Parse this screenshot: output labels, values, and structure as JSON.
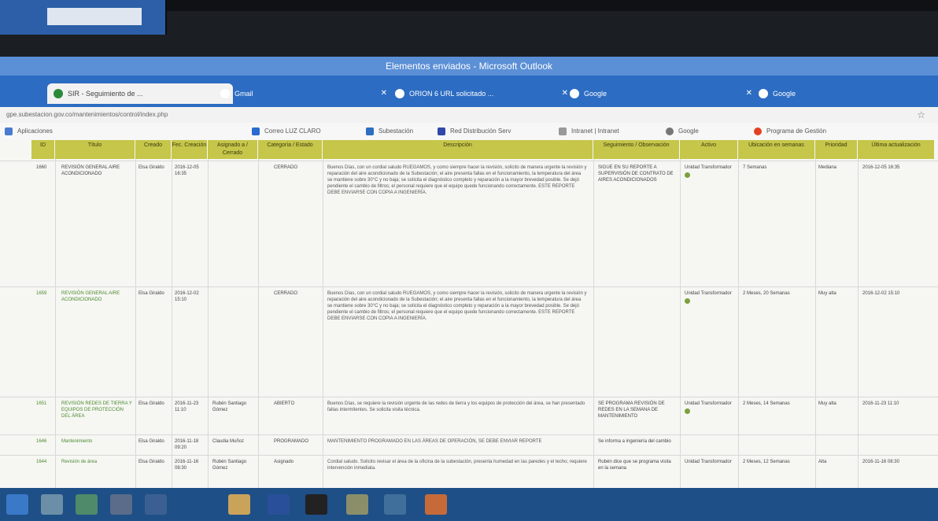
{
  "window": {
    "title": "Elementos enviados - Microsoft Outlook"
  },
  "tabs": [
    {
      "label": "SIR - Seguimiento de ...",
      "active": true
    },
    {
      "label": "Gmail",
      "active": false
    },
    {
      "label": "ORION 6 URL solicitado ...",
      "active": false
    },
    {
      "label": "Google",
      "active": false
    },
    {
      "label": "Google",
      "active": false
    }
  ],
  "address": {
    "url": "gpe.subestacion.gov.co/mantenimientos/control/index.php"
  },
  "bookmarks": [
    {
      "label": "Aplicaciones"
    },
    {
      "label": "Correo LUZ CLARO"
    },
    {
      "label": "Subestación"
    },
    {
      "label": "Red Distribución Serv"
    },
    {
      "label": "Intranet | Intranet"
    },
    {
      "label": "Google"
    },
    {
      "label": "Programa de Gestión"
    }
  ],
  "table": {
    "headers": [
      "ID",
      "Título",
      "Creado",
      "Fec. Creación",
      "Asignado a / Cerrado",
      "Categoría / Estado",
      "Descripción",
      "Seguimiento / Observación",
      "Activo",
      "Ubicación en semanas",
      "Prioridad",
      "Última actualización"
    ],
    "rows": [
      {
        "id": "1660",
        "title": "REVISIÓN GENERAL AIRE ACONDICIONADO",
        "created": "Elsa Giraldo",
        "date": "2016-12-05 16:35",
        "assigned": "",
        "category": "CERRADO",
        "description": "Buenos Días, con un cordial saludo RUEGAMOS, y como siempre hacer la revisión, solicito de manera urgente la revisión y reparación del aire acondicionado de la Subestación; el aire presenta fallas en el funcionamiento, la temperatura del área se mantiene sobre 30°C y no baja; se solicita el diagnóstico completo y reparación a la mayor brevedad posible. Se dejó pendiente el cambio de filtros; el personal requiere que el equipo quede funcionando correctamente. ESTE REPORTE DEBE ENVIARSE CON COPIA A INGENIERÍA.",
        "follow": "SIGUE EN SU REPORTE A SUPERVISIÓN DE CONTRATO DE AIRES ACONDICIONADOS",
        "asset": "Unidad Transformador",
        "weeks": "7 Semanas",
        "priority": "Mediana",
        "updated": "2016-12-05 16:35"
      },
      {
        "id": "1659",
        "title": "REVISIÓN GENERAL AIRE ACONDICIONADO",
        "created": "Elsa Giraldo",
        "date": "2016-12-02 15:10",
        "assigned": "",
        "category": "CERRADO",
        "description": "Buenos Días, con un cordial saludo RUEGAMOS, y como siempre hacer la revisión, solicito de manera urgente la revisión y reparación del aire acondicionado de la Subestación; el aire presenta fallas en el funcionamiento, la temperatura del área se mantiene sobre 30°C y no baja; se solicita el diagnóstico completo y reparación a la mayor brevedad posible. Se dejó pendiente el cambio de filtros; el personal requiere que el equipo quede funcionando correctamente. ESTE REPORTE DEBE ENVIARSE CON COPIA A INGENIERÍA.",
        "follow": "",
        "asset": "Unidad Transformador",
        "weeks": "2 Meses, 20 Semanas",
        "priority": "Muy alta",
        "updated": "2016-12-02 15:10"
      },
      {
        "id": "1651",
        "title": "REVISIÓN REDES DE TIERRA Y EQUIPOS DE PROTECCIÓN DEL ÁREA",
        "created": "Elsa Giraldo",
        "date": "2016-11-23 11:10",
        "assigned": "Rubén Santiago Gómez",
        "category": "ABIERTO",
        "description": "Buenos Días, se requiere la revisión urgente de las redes de tierra y los equipos de protección del área, se han presentado fallas intermitentes. Se solicita visita técnica.",
        "follow": "SE PROGRAMA REVISIÓN DE REDES EN LA SEMANA DE MANTENIMIENTO",
        "asset": "Unidad Transformador",
        "weeks": "2 Meses, 14 Semanas",
        "priority": "Muy alta",
        "updated": "2016-11-23 11:10"
      },
      {
        "id": "1646",
        "title": "Mantenimiento",
        "created": "Elsa Giraldo",
        "date": "2016-11-18 09:20",
        "assigned": "Claudia Muñoz",
        "category": "PROGRAMADO",
        "description": "MANTENIMIENTO PROGRAMADO EN LAS ÁREAS DE OPERACIÓN, SE DEBE ENVIAR REPORTE",
        "follow": "Se informa a ingeniería del cambio",
        "asset": "",
        "weeks": "",
        "priority": "",
        "updated": ""
      },
      {
        "id": "1644",
        "title": "Revisión de área",
        "created": "Elsa Giraldo",
        "date": "2016-11-16 08:30",
        "assigned": "Rubén Santiago Gómez",
        "category": "Asignado",
        "description": "Cordial saludo. Solicito revisar el área de la oficina de la subestación, presenta humedad en las paredes y el techo; requiere intervención inmediata.",
        "follow": "Rubén dice que se programa visita en la semana",
        "asset": "Unidad Transformador",
        "weeks": "2 Meses, 12 Semanas",
        "priority": "Alta",
        "updated": "2016-11-16 08:30"
      }
    ]
  },
  "colors": {
    "header_bg": "#c6c64a",
    "chrome_blue": "#2c6cc2",
    "taskbar": "#1e4f86"
  }
}
